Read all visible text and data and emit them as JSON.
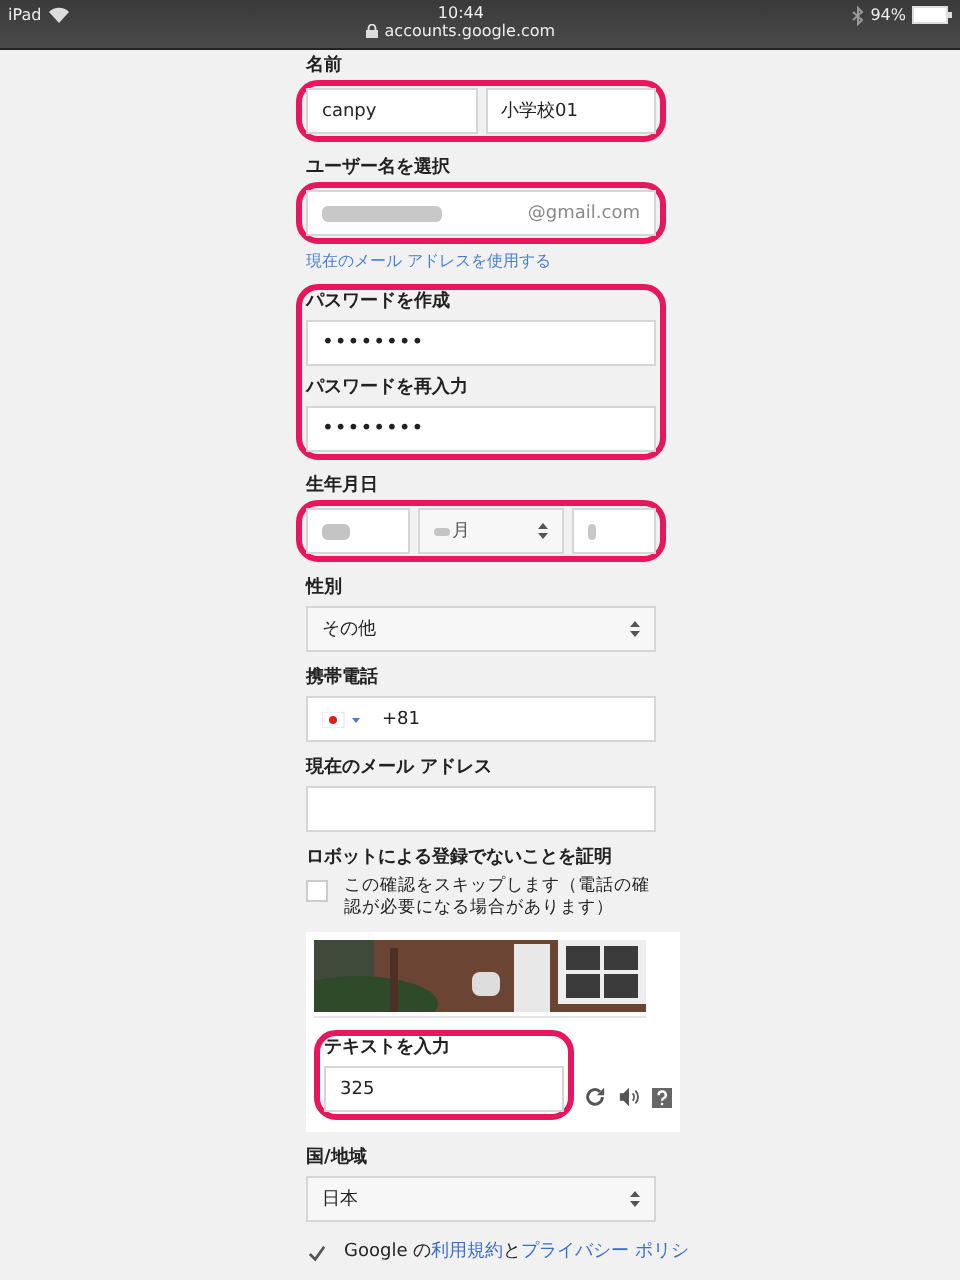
{
  "status_bar": {
    "device": "iPad",
    "time": "10:44",
    "url": "accounts.google.com",
    "battery": "94%"
  },
  "sections": [
    {
      "kind": "name",
      "label": "名前",
      "values": [
        "canpy",
        "小学校01"
      ],
      "highlighted": true
    },
    {
      "kind": "username",
      "label": "ユーザー名を選択",
      "suffix": "@gmail.com",
      "link": "現在のメール アドレスを使用する",
      "highlighted": true
    },
    {
      "kind": "passwords",
      "fields": [
        {
          "label": "パスワードを作成",
          "value": "••••••••"
        },
        {
          "label": "パスワードを再入力",
          "value": "••••••••"
        }
      ],
      "highlighted": true
    },
    {
      "kind": "birthday",
      "label": "生年月日",
      "month_unit": "月",
      "highlighted": true
    },
    {
      "kind": "select",
      "label": "性別",
      "value": "その他",
      "highlighted": false
    },
    {
      "kind": "phone",
      "label": "携帯電話",
      "value": "+81",
      "highlighted": false
    },
    {
      "kind": "text",
      "label": "現在のメール アドレス",
      "highlighted": false
    },
    {
      "kind": "captcha",
      "label": "ロボットによる登録でないことを証明",
      "skip": {
        "checked": false,
        "text": "この確認をスキップします（電話の確認が必要になる場合があります）"
      },
      "input_label": "テキストを入力",
      "value": "325",
      "highlighted": true
    },
    {
      "kind": "select",
      "label": "国/地域",
      "value": "日本",
      "highlighted": false
    }
  ],
  "agree": {
    "checked": true,
    "parts": [
      {
        "kind": "plain",
        "text": "Google の"
      },
      {
        "kind": "link",
        "text": "利用規約"
      },
      {
        "kind": "plain",
        "text": "と"
      },
      {
        "kind": "link",
        "text": "プライバシー ポリシ"
      }
    ]
  }
}
